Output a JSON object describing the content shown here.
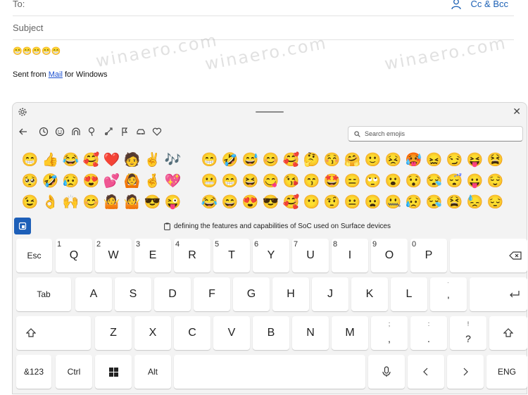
{
  "mail": {
    "to_label": "To:",
    "cc_bcc": "Cc & Bcc",
    "subject_placeholder": "Subject",
    "body_emojis": "😁😁😁😁😁",
    "sent_prefix": "Sent from ",
    "sent_link": "Mail",
    "sent_suffix": " for Windows",
    "watermark": "winaero.com"
  },
  "panel": {
    "search_placeholder": "Search emojis",
    "categories": [
      "back-icon",
      "recent-icon",
      "smiley-icon",
      "people-icon",
      "celebration-icon",
      "food-icon",
      "flag-icon",
      "car-icon",
      "heart-icon"
    ],
    "recent_emojis": [
      "😁",
      "👍",
      "😂",
      "🥰",
      "❤️",
      "🧑",
      "✌️",
      "🎶",
      "🥺",
      "🤣",
      "😥",
      "😍",
      "💕",
      "🙆",
      "🤞",
      "💖",
      "😉",
      "👌",
      "🙌",
      "😊",
      "🤷",
      "🤷",
      "😎",
      "😜"
    ],
    "all_emojis": [
      "😁",
      "🤣",
      "😅",
      "😊",
      "🥰",
      "🤔",
      "😚",
      "🤗",
      "🙂",
      "😣",
      "🥵",
      "😖",
      "😏",
      "😝",
      "😫",
      "",
      "😬",
      "😁",
      "😆",
      "😋",
      "😘",
      "😙",
      "🤩",
      "😑",
      "🙄",
      "😮",
      "😯",
      "😪",
      "😴",
      "😛",
      "😌",
      "",
      "😂",
      "😄",
      "😍",
      "😎",
      "🥰",
      "😶",
      "🤨",
      "😐",
      "😦",
      "🤐",
      "😥",
      "😪",
      "😫",
      "😓",
      "😔",
      ""
    ],
    "suggestion": "defining the features and capabilities of SoC used on Surface devices"
  },
  "keyboard": {
    "row1": [
      {
        "label": "Q",
        "num": "1"
      },
      {
        "label": "W",
        "num": "2"
      },
      {
        "label": "E",
        "num": "3"
      },
      {
        "label": "R",
        "num": "4"
      },
      {
        "label": "T",
        "num": "5"
      },
      {
        "label": "Y",
        "num": "6"
      },
      {
        "label": "U",
        "num": "7"
      },
      {
        "label": "I",
        "num": "8"
      },
      {
        "label": "O",
        "num": "9"
      },
      {
        "label": "P",
        "num": "0"
      }
    ],
    "row2": [
      "A",
      "S",
      "D",
      "F",
      "G",
      "H",
      "J",
      "K",
      "L"
    ],
    "row3": [
      "Z",
      "X",
      "C",
      "V",
      "B",
      "N",
      "M"
    ],
    "esc": "Esc",
    "tab": "Tab",
    "sym": "&123",
    "ctrl": "Ctrl",
    "alt": "Alt",
    "lang": "ENG",
    "semicolon_up": "˙",
    "semicolon_down": "'",
    "comma_up": ";",
    "comma_down": ",",
    "period_up": ":",
    "period_down": ".",
    "question_up": "!",
    "question_down": "?"
  }
}
